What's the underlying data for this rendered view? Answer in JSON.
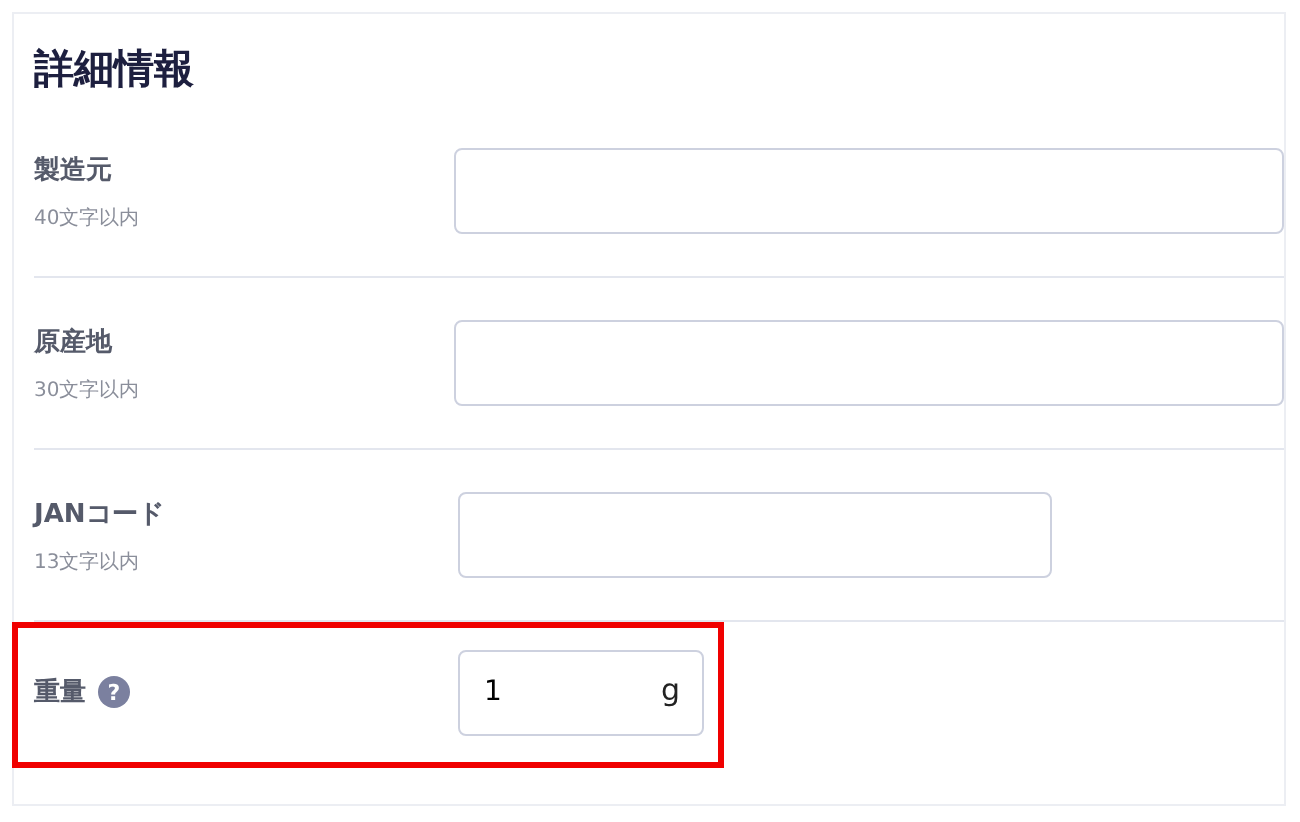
{
  "section": {
    "title": "詳細情報"
  },
  "fields": [
    {
      "kind": "wide",
      "label": "製造元",
      "hint": "40文字以内",
      "highlighted": false
    },
    {
      "kind": "wide",
      "label": "原産地",
      "hint": "30文字以内",
      "highlighted": false
    },
    {
      "kind": "medium",
      "label": "JANコード",
      "hint": "13文字以内",
      "highlighted": false
    },
    {
      "kind": "unit",
      "label": "重量",
      "help": "?",
      "value": "1",
      "unit": "g",
      "highlighted": true
    }
  ]
}
